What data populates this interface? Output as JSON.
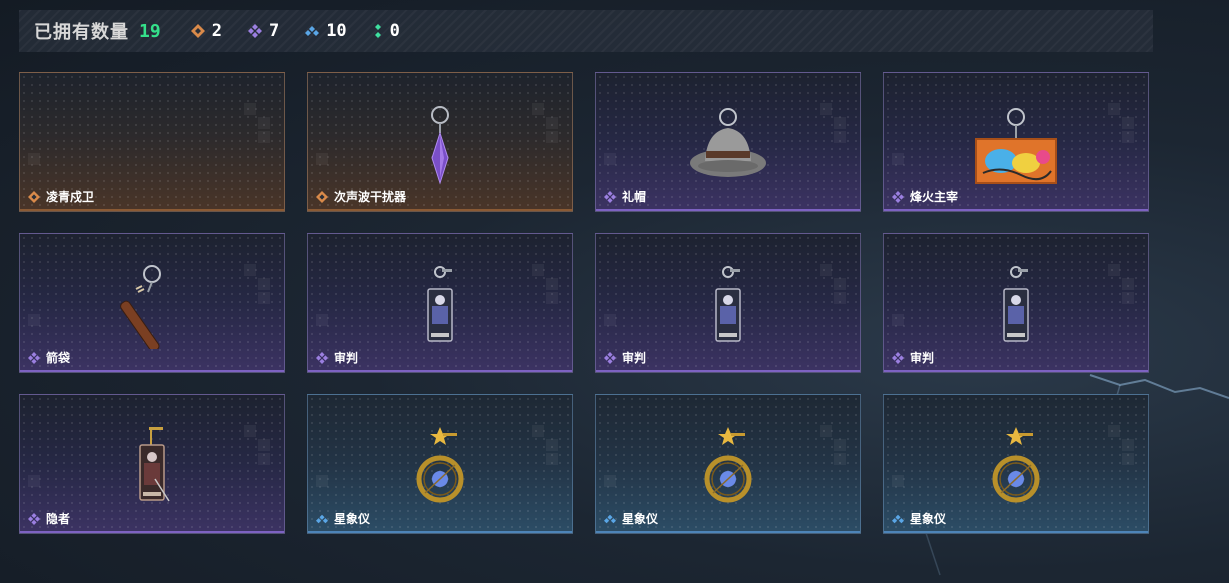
{
  "header": {
    "owned_label": "已拥有数量",
    "owned_count": "19",
    "stats": [
      {
        "rarity": "orange",
        "icon": "orange-diamond-icon",
        "value": "2"
      },
      {
        "rarity": "purple",
        "icon": "purple-diamond-icon",
        "value": "7"
      },
      {
        "rarity": "blue",
        "icon": "blue-diamond-icon",
        "value": "10"
      },
      {
        "rarity": "green",
        "icon": "green-diamond-icon",
        "value": "0"
      }
    ]
  },
  "colors": {
    "orange": "#d98a4a",
    "purple": "#9b7fe0",
    "blue": "#5aa6e6",
    "green": "#3fe0a0",
    "count": "#34e08a"
  },
  "cards": [
    {
      "name": "凌青戍卫",
      "rarity": "orange",
      "item": "empty"
    },
    {
      "name": "次声波干扰器",
      "rarity": "orange",
      "item": "crystal-pendant"
    },
    {
      "name": "礼帽",
      "rarity": "purple",
      "item": "fedora-hat"
    },
    {
      "name": "烽火主宰",
      "rarity": "purple",
      "item": "graffiti-container"
    },
    {
      "name": "箭袋",
      "rarity": "purple",
      "item": "quiver"
    },
    {
      "name": "审判",
      "rarity": "purple",
      "item": "judgment-card"
    },
    {
      "name": "审判",
      "rarity": "purple",
      "item": "judgment-card"
    },
    {
      "name": "审判",
      "rarity": "purple",
      "item": "judgment-card"
    },
    {
      "name": "隐者",
      "rarity": "purple",
      "item": "hermit-card"
    },
    {
      "name": "星象仪",
      "rarity": "blue",
      "item": "astrolabe"
    },
    {
      "name": "星象仪",
      "rarity": "blue",
      "item": "astrolabe"
    },
    {
      "name": "星象仪",
      "rarity": "blue",
      "item": "astrolabe"
    }
  ]
}
